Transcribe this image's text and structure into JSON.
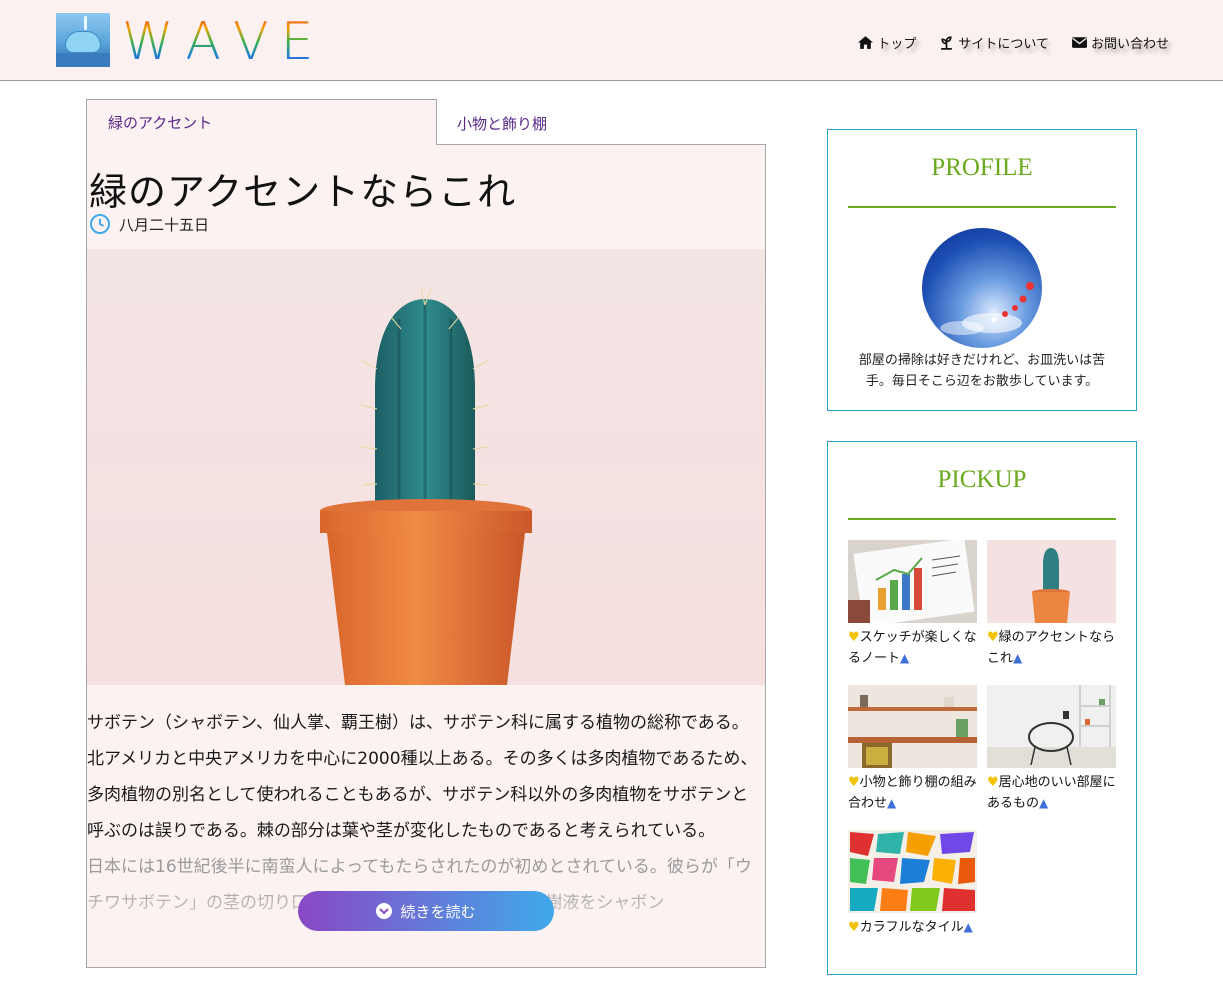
{
  "header": {
    "logo_text": [
      "W",
      "A",
      "V",
      "E"
    ],
    "nav": [
      {
        "label": "トップ",
        "icon": "home-icon"
      },
      {
        "label": "サイトについて",
        "icon": "plant-icon"
      },
      {
        "label": "お問い合わせ",
        "icon": "envelope-icon"
      }
    ]
  },
  "tabs": {
    "active": "緑のアクセント",
    "other": "小物と飾り棚"
  },
  "article": {
    "title": "緑のアクセントならこれ",
    "date": "八月二十五日",
    "paragraph1": "サボテン（シャボテン、仙人掌、覇王樹）は、サボテン科に属する植物の総称である。北アメリカと中央アメリカを中心に2000種以上ある。その多くは多肉植物であるため、多肉植物の別名として使われることもあるが、サボテン科以外の多肉植物をサボテンと呼ぶのは誤りである。棘の部分は葉や茎が変化したものであると考えられている。",
    "paragraph2": "日本には16世紀後半に南蛮人によってもたらされたのが初めとされている。彼らが「ウチワサボテン」の茎の切り口で畳や衣服の汚れをふき取り、樹液をシャボン",
    "read_more": "続きを読む"
  },
  "profile": {
    "title": "PROFILE",
    "text": "部屋の掃除は好きだけれど、お皿洗いは苦手。毎日そこら辺をお散歩しています。"
  },
  "pickup": {
    "title": "PICKUP",
    "items": [
      {
        "caption": "スケッチが楽しくなるノート"
      },
      {
        "caption": "緑のアクセントならこれ"
      },
      {
        "caption": "小物と飾り棚の組み合わせ"
      },
      {
        "caption": "居心地のいい部屋にあるもの"
      },
      {
        "caption": "カラフルなタイル"
      }
    ]
  },
  "colors": {
    "header_bg": "#fcf1f1",
    "accent_green": "#6aaa1e",
    "box_border": "#2aa3c8",
    "readmore_start": "#8a48c4",
    "readmore_end": "#3fa9ea"
  }
}
